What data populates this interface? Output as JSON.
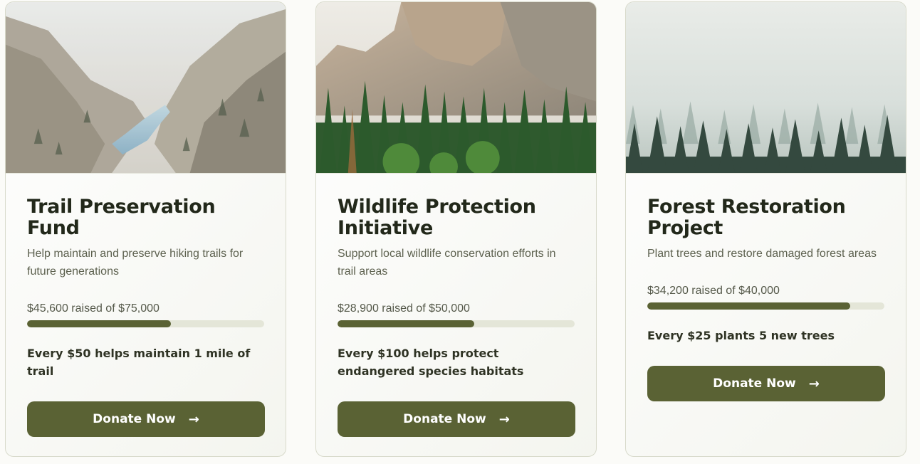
{
  "cards": [
    {
      "title": "Trail Preservation Fund",
      "description": "Help maintain and preserve hiking trails for future generations",
      "raised_text": "$45,600 raised of $75,000",
      "progress": 0.608,
      "impact": "Every $50 helps maintain 1 mile of trail",
      "button_label": "Donate Now",
      "image_icon": "canyon-river-image"
    },
    {
      "title": "Wildlife Protection Initiative",
      "description": "Support local wildlife conservation efforts in trail areas",
      "raised_text": "$28,900 raised of $50,000",
      "progress": 0.578,
      "impact": "Every $100 helps protect endangered species habitats",
      "button_label": "Donate Now",
      "image_icon": "mountain-forest-image"
    },
    {
      "title": "Forest Restoration Project",
      "description": "Plant trees and restore damaged forest areas",
      "raised_text": "$34,200 raised of $40,000",
      "progress": 0.855,
      "impact": "Every $25 plants 5 new trees",
      "button_label": "Donate Now",
      "image_icon": "foggy-forest-image"
    }
  ],
  "colors": {
    "accent": "#5a6234",
    "track": "#e4e6d8",
    "title": "#22281a"
  },
  "icons": {
    "button_arrow": "arrow-right-icon",
    "arrow_glyph": "→"
  }
}
